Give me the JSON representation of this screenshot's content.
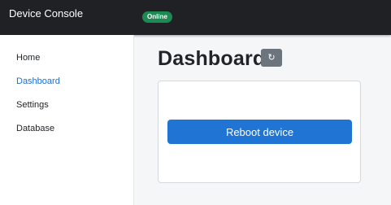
{
  "header": {
    "app_title": "Device Console",
    "status_badge": "Online",
    "status_color": "#1e8a53"
  },
  "sidebar": {
    "items": [
      {
        "label": "Home",
        "active": false
      },
      {
        "label": "Dashboard",
        "active": true
      },
      {
        "label": "Settings",
        "active": false
      },
      {
        "label": "Database",
        "active": false
      }
    ]
  },
  "main": {
    "title": "Dashboard",
    "refresh_icon": "↻",
    "card": {
      "button_label": "Reboot device"
    }
  },
  "colors": {
    "accent": "#1f74d4",
    "active_link": "#1a6fd1",
    "topbar": "#1f2124"
  }
}
